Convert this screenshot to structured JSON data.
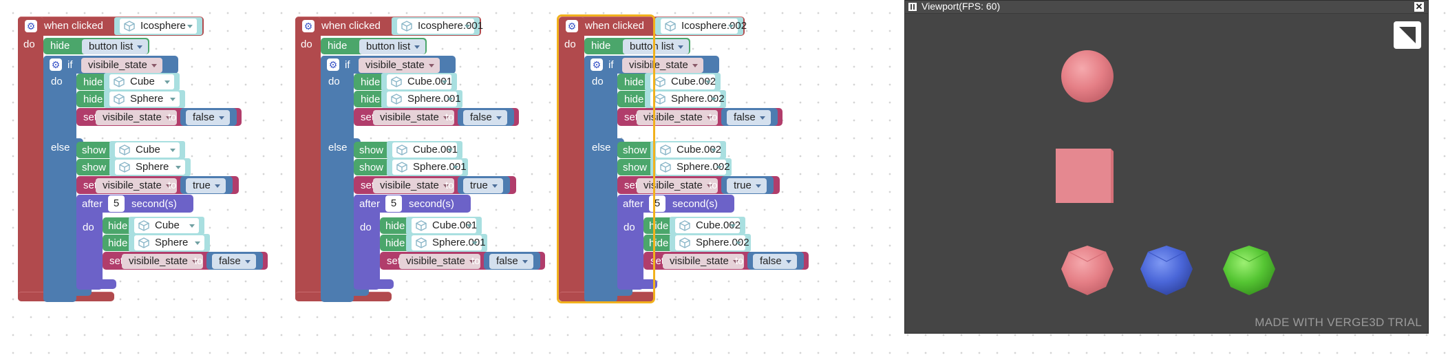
{
  "stacks": [
    {
      "event": "when clicked",
      "event_object": "Icosphere",
      "do": "do",
      "hide": "hide",
      "show": "show",
      "if": "if",
      "else": "else",
      "set": "set",
      "to": "to",
      "after": "after",
      "seconds": "second(s)",
      "button_list": "button list",
      "var": "visibile_state",
      "obj_a": "Cube",
      "obj_b": "Sphere",
      "val_false": "false",
      "val_true": "true",
      "delay": "5"
    },
    {
      "event": "when clicked",
      "event_object": "Icosphere.001",
      "do": "do",
      "hide": "hide",
      "show": "show",
      "if": "if",
      "else": "else",
      "set": "set",
      "to": "to",
      "after": "after",
      "seconds": "second(s)",
      "button_list": "button list",
      "var": "visibile_state",
      "obj_a": "Cube.001",
      "obj_b": "Sphere.001",
      "val_false": "false",
      "val_true": "true",
      "delay": "5"
    },
    {
      "event": "when clicked",
      "event_object": "Icosphere.002",
      "do": "do",
      "hide": "hide",
      "show": "show",
      "if": "if",
      "else": "else",
      "set": "set",
      "to": "to",
      "after": "after",
      "seconds": "second(s)",
      "button_list": "button list",
      "var": "visibile_state",
      "obj_a": "Cube.002",
      "obj_b": "Sphere.002",
      "val_false": "false",
      "val_true": "true",
      "delay": "5"
    }
  ],
  "viewport": {
    "title": "Viewport(FPS: 60)",
    "watermark": "MADE WITH VERGE3D TRIAL",
    "objects": [
      {
        "name": "sphere",
        "color": "#e57f86"
      },
      {
        "name": "cube",
        "color": "#e28088"
      },
      {
        "name": "icosphere-red",
        "color": "#e07b84"
      },
      {
        "name": "icosphere-blue",
        "color": "#4a66d8"
      },
      {
        "name": "icosphere-green",
        "color": "#55c533"
      }
    ]
  },
  "colors": {
    "event": "#b14a4d",
    "looks": "#4ba66b",
    "logic": "#4d7cb0",
    "timer": "#6c62c8",
    "variable": "#b13d6b",
    "selection": "#f1b11d"
  }
}
